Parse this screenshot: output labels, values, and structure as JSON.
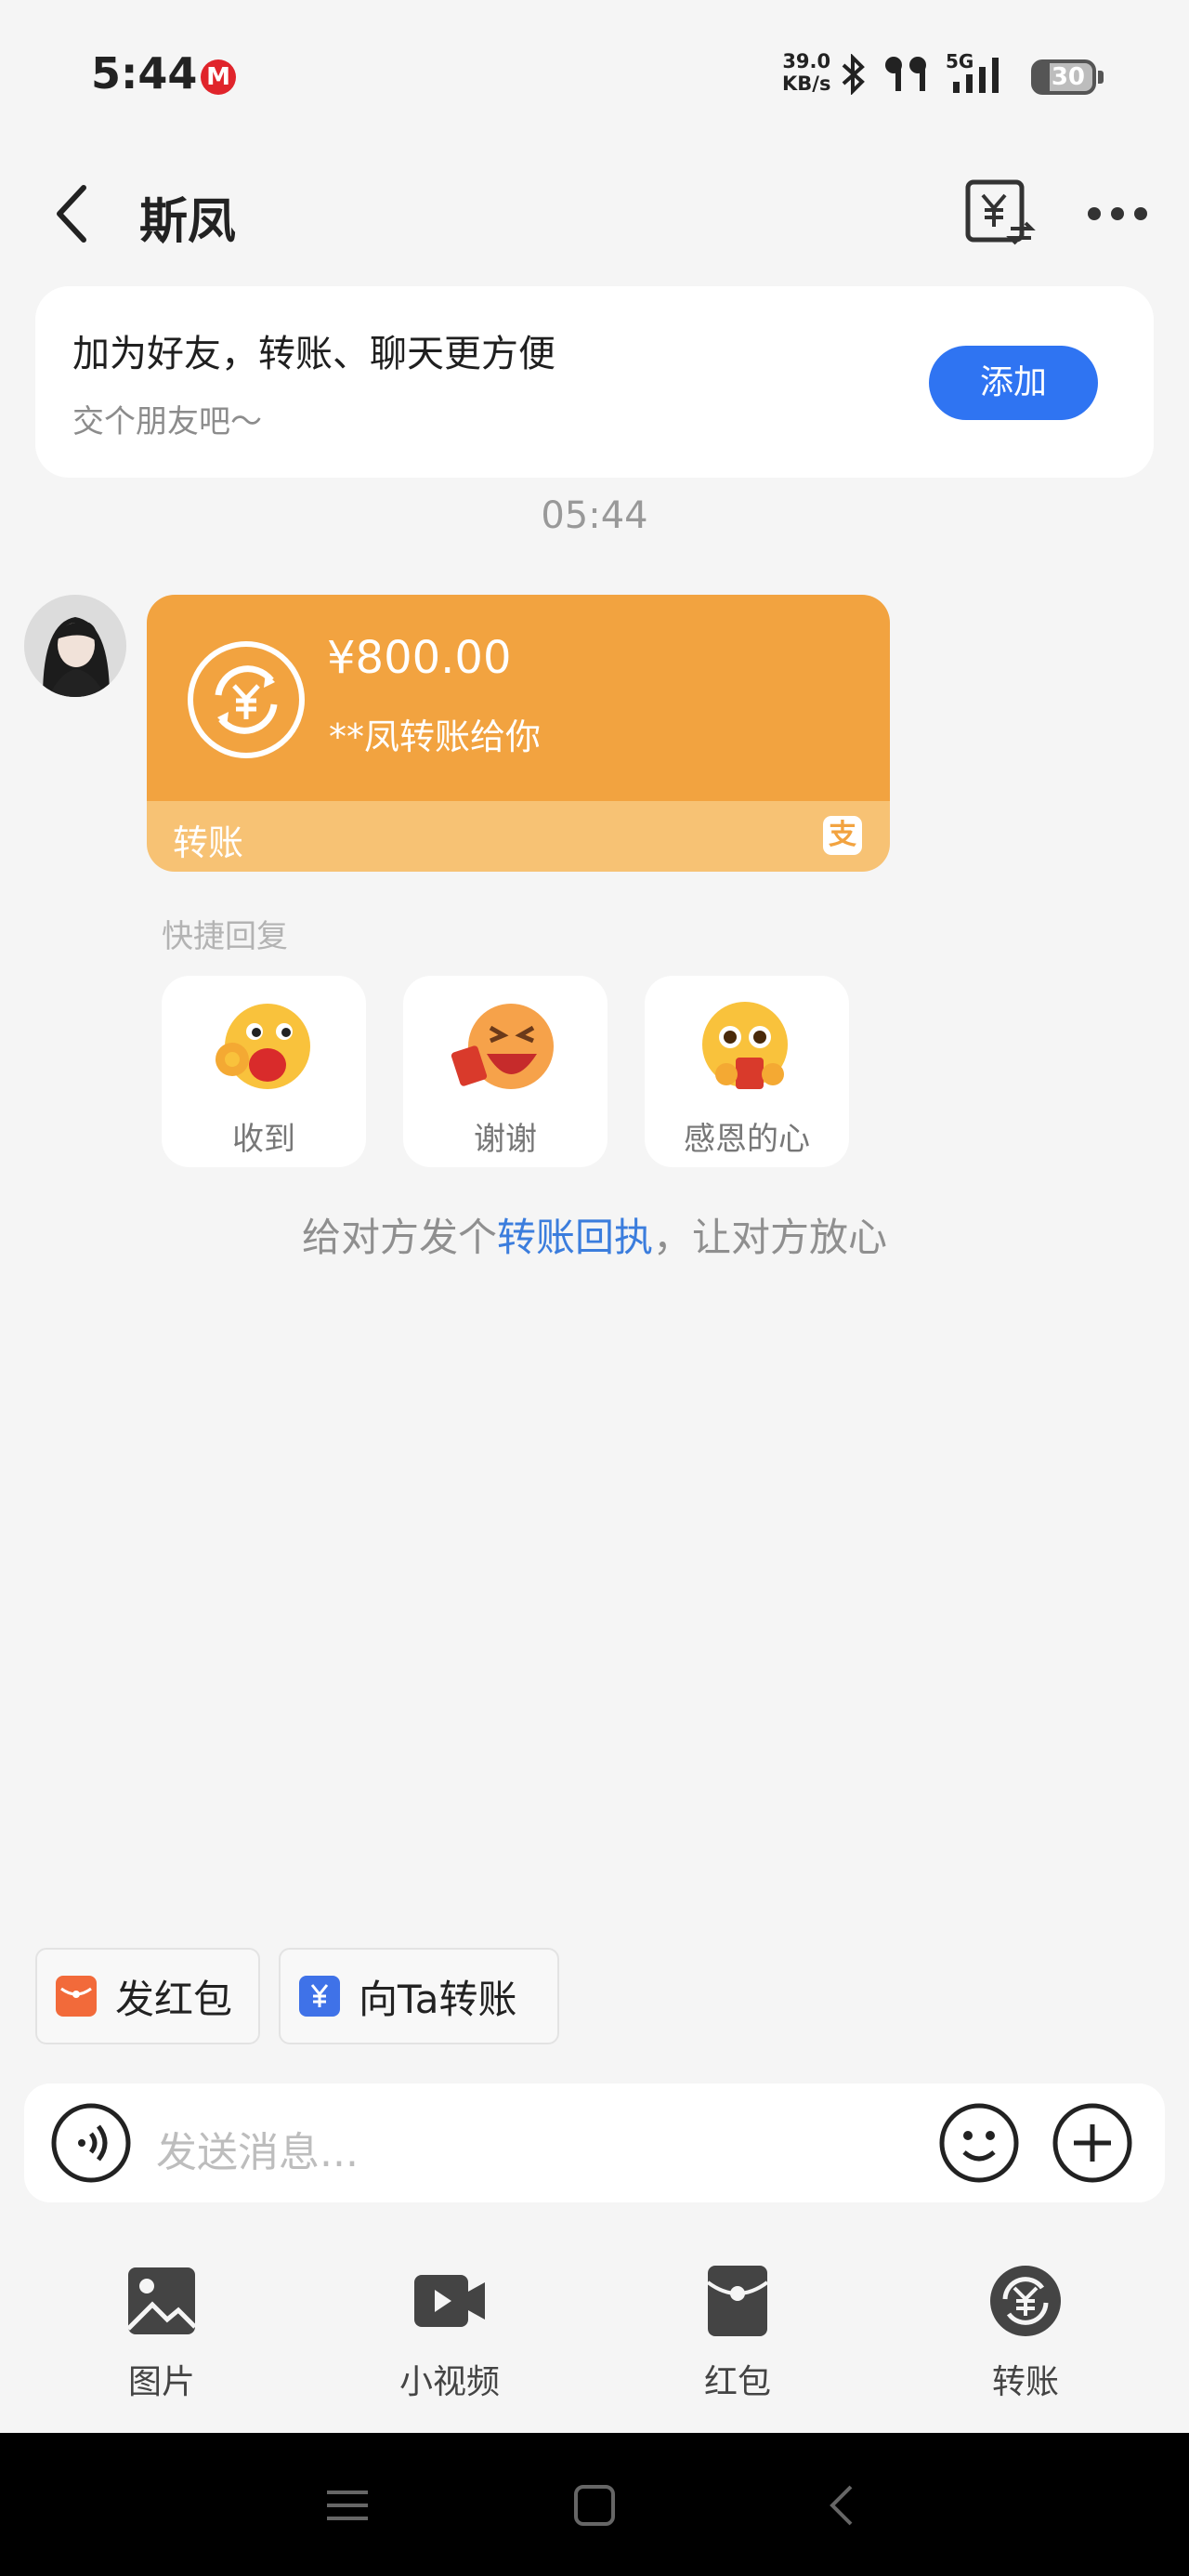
{
  "status_bar": {
    "time": "5:44",
    "metro_icon": "metro-logo",
    "net_speed_value": "39.0",
    "net_speed_unit": "KB/s",
    "signal_label": "5G",
    "battery": "30"
  },
  "header": {
    "title": "斯凤",
    "back_icon": "chevron-left-icon",
    "bill_icon": "yuan-transfer-icon",
    "more_icon": "more-dots-icon"
  },
  "friend_card": {
    "title": "加为好友，转账、聊天更方便",
    "subtitle": "交个朋友吧～",
    "add_button": "添加"
  },
  "chat": {
    "timestamp": "05:44",
    "transfer": {
      "amount": "¥800.00",
      "description": "**凤转账给你",
      "label": "转账",
      "brand_mark": "支"
    },
    "quick_reply_title": "快捷回复",
    "quick_replies": [
      {
        "label": "收到",
        "icon": "ok-emoji-icon"
      },
      {
        "label": "谢谢",
        "icon": "thanks-emoji-icon"
      },
      {
        "label": "感恩的心",
        "icon": "grateful-emoji-icon"
      }
    ],
    "receipt_prefix": "给对方发个",
    "receipt_link": "转账回执",
    "receipt_suffix": "，让对方放心"
  },
  "shortcuts": {
    "red_packet": "发红包",
    "transfer": "向Ta转账"
  },
  "input": {
    "placeholder": "发送消息..."
  },
  "tools": [
    {
      "label": "图片",
      "icon": "image-icon"
    },
    {
      "label": "小视频",
      "icon": "video-icon"
    },
    {
      "label": "红包",
      "icon": "red-packet-icon"
    },
    {
      "label": "转账",
      "icon": "transfer-icon"
    }
  ],
  "colors": {
    "accent_blue": "#2f74f2",
    "transfer_orange": "#f2a340",
    "transfer_light": "#f7c274",
    "link_blue": "#3b7ddd"
  }
}
